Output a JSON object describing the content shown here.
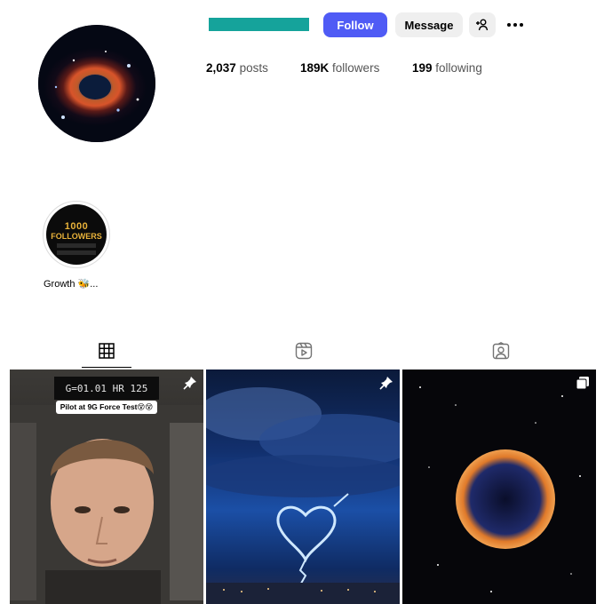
{
  "profile": {
    "username_redacted": true,
    "follow_label": "Follow",
    "message_label": "Message",
    "stats": {
      "posts_count": "2,037",
      "posts_label": "posts",
      "followers_count": "189K",
      "followers_label": "followers",
      "following_count": "199",
      "following_label": "following"
    }
  },
  "highlights": [
    {
      "label": "Growth 🐝...",
      "cover_line1": "1000",
      "cover_line2": "FOLLOWERS"
    }
  ],
  "tabs": [
    {
      "name": "posts",
      "icon": "grid-icon",
      "active": true
    },
    {
      "name": "reels",
      "icon": "reels-icon",
      "active": false
    },
    {
      "name": "tagged",
      "icon": "tagged-icon",
      "active": false
    }
  ],
  "posts": [
    {
      "overlay_text": "G=01.01 HR 125",
      "caption": "Pilot at 9G Force Test😵😵",
      "pinned": true
    },
    {
      "pinned": true
    },
    {
      "carousel": true
    }
  ],
  "colors": {
    "follow_button": "#4f5bf5",
    "username_redaction": "#15a39b",
    "secondary_button": "#efefef"
  }
}
